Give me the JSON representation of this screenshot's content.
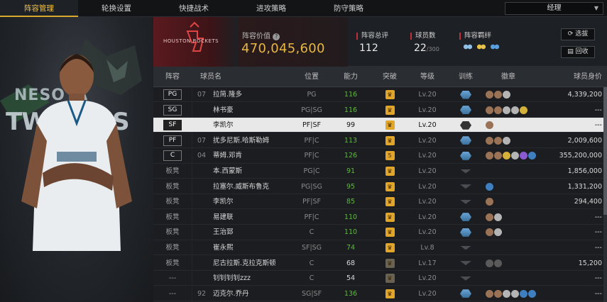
{
  "tabs": [
    "阵容管理",
    "轮换设置",
    "快捷战术",
    "进攻策略",
    "防守策略"
  ],
  "role_select": "经理",
  "player_bg": {
    "line1": "NESOTA",
    "line2": "TWOLVES"
  },
  "team": {
    "name": "HOUSTON ROCKETS",
    "value_label": "阵容价值",
    "value": "470,045,600"
  },
  "stats": {
    "rating_label": "阵容总评",
    "rating": "112",
    "count_label": "球员数",
    "count": "22",
    "count_max": "/300",
    "chem_label": "阵容羁绊"
  },
  "buttons": {
    "select": "选拔",
    "recall": "回收"
  },
  "columns": [
    "阵容",
    "球员名",
    "位置",
    "能力",
    "突破",
    "等级",
    "训练",
    "徽章",
    "球员身价"
  ],
  "colors": {
    "accent": "#d8a82c",
    "value": "#e8b742",
    "green": "#5dbb3c",
    "red": "#c0303a"
  },
  "rows": [
    {
      "slot": "PG",
      "starter": true,
      "num": "07",
      "name": "拉简.隆多",
      "pos": "PG",
      "ability": "116",
      "green": true,
      "break": "crown",
      "level": "Lv.20",
      "train": "blue",
      "badges": [
        "bronze",
        "bronze",
        "silver"
      ],
      "price": "4,339,200"
    },
    {
      "slot": "SG",
      "starter": true,
      "num": "",
      "name": "林书豪",
      "pos": "PG|SG",
      "ability": "116",
      "green": true,
      "break": "crown",
      "level": "Lv.20",
      "train": "blue",
      "badges": [
        "bronze",
        "bronze",
        "silver",
        "silver",
        "gold"
      ],
      "price": "---"
    },
    {
      "slot": "SF",
      "starter": true,
      "num": "",
      "name": "李凯尔",
      "pos": "PF|SF",
      "ability": "99",
      "green": false,
      "break": "crown",
      "level": "Lv.20",
      "train": "dark",
      "badges": [
        "bronze"
      ],
      "price": "---",
      "selected": true
    },
    {
      "slot": "PF",
      "starter": true,
      "num": "07",
      "name": "扰多尼斯.哈斯勒姆",
      "pos": "PF|C",
      "ability": "113",
      "green": true,
      "break": "crown",
      "level": "Lv.20",
      "train": "blue",
      "badges": [
        "bronze",
        "bronze",
        "silver"
      ],
      "price": "2,009,600"
    },
    {
      "slot": "C",
      "starter": true,
      "num": "04",
      "name": "蒂姆.邓肯",
      "pos": "PF|C",
      "ability": "126",
      "green": true,
      "break": "5",
      "level": "Lv.20",
      "train": "blue",
      "badges": [
        "bronze",
        "bronze",
        "gold",
        "silver",
        "purple",
        "blue"
      ],
      "price": "355,200,000"
    },
    {
      "slot": "板凳",
      "starter": false,
      "num": "",
      "name": "本.西蒙斯",
      "pos": "PG|C",
      "ability": "91",
      "green": true,
      "break": "crown",
      "level": "Lv.20",
      "train": "none",
      "badges": [],
      "price": "1,856,000"
    },
    {
      "slot": "板凳",
      "starter": false,
      "num": "",
      "name": "拉塞尔.威斯布鲁克",
      "pos": "PG|SG",
      "ability": "95",
      "green": true,
      "break": "crown",
      "level": "Lv.20",
      "train": "none",
      "badges": [
        "blue"
      ],
      "price": "1,331,200"
    },
    {
      "slot": "板凳",
      "starter": false,
      "num": "",
      "name": "李凯尔",
      "pos": "PF|SF",
      "ability": "85",
      "green": true,
      "break": "crown",
      "level": "Lv.20",
      "train": "none",
      "badges": [
        "bronze"
      ],
      "price": "294,400"
    },
    {
      "slot": "板凳",
      "starter": false,
      "num": "",
      "name": "易建联",
      "pos": "PF|C",
      "ability": "110",
      "green": true,
      "break": "crown",
      "level": "Lv.20",
      "train": "blue",
      "badges": [
        "bronze",
        "silver"
      ],
      "price": "---"
    },
    {
      "slot": "板凳",
      "starter": false,
      "num": "",
      "name": "王治郅",
      "pos": "C",
      "ability": "110",
      "green": true,
      "break": "crown",
      "level": "Lv.20",
      "train": "blue",
      "badges": [
        "bronze",
        "silver"
      ],
      "price": "---"
    },
    {
      "slot": "板凳",
      "starter": false,
      "num": "",
      "name": "崔永熙",
      "pos": "SF|SG",
      "ability": "74",
      "green": true,
      "break": "crown",
      "level": "Lv.8",
      "train": "none",
      "badges": [],
      "price": "---"
    },
    {
      "slot": "板凳",
      "starter": false,
      "num": "",
      "name": "尼古拉斯.克拉克斯顿",
      "pos": "C",
      "ability": "68",
      "green": false,
      "break": "dim",
      "level": "Lv.17",
      "train": "none",
      "badges": [
        "dark",
        "dark"
      ],
      "price": "15,200"
    },
    {
      "slot": "---",
      "starter": false,
      "num": "",
      "name": "钊钊钊钊zzz",
      "pos": "C",
      "ability": "54",
      "green": false,
      "break": "dim",
      "level": "Lv.20",
      "train": "none",
      "badges": [],
      "price": "---"
    },
    {
      "slot": "---",
      "starter": false,
      "num": "92",
      "name": "迈克尔.乔丹",
      "pos": "SG|SF",
      "ability": "136",
      "green": true,
      "break": "crown",
      "level": "Lv.20",
      "train": "blue",
      "badges": [
        "bronze",
        "bronze",
        "silver",
        "silver",
        "blue",
        "blue"
      ],
      "price": "---"
    }
  ]
}
